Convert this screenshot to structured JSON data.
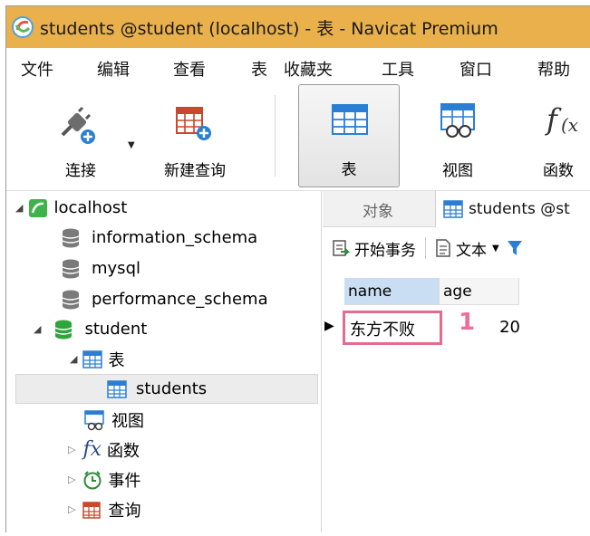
{
  "window": {
    "title": "students @student (localhost) - 表 - Navicat Premium"
  },
  "menu": [
    "文件",
    "编辑",
    "查看",
    "表",
    "收藏夹",
    "工具",
    "窗口",
    "帮助"
  ],
  "toolbar": {
    "buttons": [
      {
        "label": "连接",
        "icon": "connection-plug-icon"
      },
      {
        "label": "新建查询",
        "icon": "new-query-icon"
      },
      {
        "label": "表",
        "icon": "table-icon",
        "selected": true
      },
      {
        "label": "视图",
        "icon": "view-icon"
      },
      {
        "label": "函数",
        "icon": "function-icon"
      }
    ]
  },
  "tree": {
    "items": [
      {
        "label": "localhost",
        "icon": "server-icon",
        "expanded": true
      },
      {
        "label": "information_schema",
        "icon": "database-icon"
      },
      {
        "label": "mysql",
        "icon": "database-icon"
      },
      {
        "label": "performance_schema",
        "icon": "database-icon"
      },
      {
        "label": "student",
        "icon": "database-icon",
        "expanded": true
      },
      {
        "label": "表",
        "icon": "table-icon",
        "expanded": true
      },
      {
        "label": "students",
        "icon": "table-icon",
        "selected": true
      },
      {
        "label": "视图",
        "icon": "view-icon"
      },
      {
        "label": "函数",
        "icon": "function-icon"
      },
      {
        "label": "事件",
        "icon": "clock-icon"
      },
      {
        "label": "查询",
        "icon": "query-icon"
      }
    ]
  },
  "tabs": {
    "objects": "对象",
    "students": "students @st"
  },
  "subtoolbar": {
    "begin_transaction": "开始事务",
    "text": "文本"
  },
  "grid": {
    "columns": [
      "name",
      "age"
    ],
    "rows": [
      [
        "东方不败",
        "20"
      ]
    ]
  },
  "annotation": {
    "marker": "1",
    "color": "#ef6f97"
  },
  "colors": {
    "titlebar": "#e9b04c",
    "selected_column": "#c9def3",
    "highlight_box": "#e26b8e"
  }
}
